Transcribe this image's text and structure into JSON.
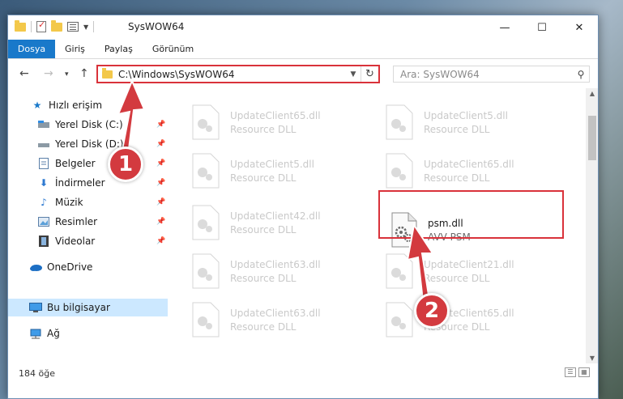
{
  "window": {
    "title": "SysWOW64",
    "controls": {
      "minimize": "—",
      "maximize": "☐",
      "close": "✕"
    }
  },
  "ribbon": {
    "tabs": [
      "Dosya",
      "Giriş",
      "Paylaş",
      "Görünüm"
    ]
  },
  "address": {
    "path": "C:\\Windows\\SysWOW64",
    "search_placeholder": "Ara: SysWOW64"
  },
  "sidebar": {
    "items": [
      {
        "label": "Hızlı erişim",
        "icon": "star-icon",
        "pinned": false
      },
      {
        "label": "Yerel Disk (C:)",
        "icon": "drive-icon",
        "pinned": true
      },
      {
        "label": "Yerel Disk (D:)",
        "icon": "drive-icon",
        "pinned": true
      },
      {
        "label": "Belgeler",
        "icon": "documents-icon",
        "pinned": true
      },
      {
        "label": "İndirmeler",
        "icon": "download-icon",
        "pinned": true
      },
      {
        "label": "Müzik",
        "icon": "music-icon",
        "pinned": true
      },
      {
        "label": "Resimler",
        "icon": "pictures-icon",
        "pinned": true
      },
      {
        "label": "Videolar",
        "icon": "videos-icon",
        "pinned": true
      },
      {
        "label": "OneDrive",
        "icon": "cloud-icon",
        "pinned": false
      },
      {
        "label": "Bu bilgisayar",
        "icon": "computer-icon",
        "pinned": false,
        "selected": true
      },
      {
        "label": "Ağ",
        "icon": "network-icon",
        "pinned": false
      }
    ]
  },
  "files": [
    {
      "name": "UpdateClient65.dll",
      "type": "Resource DLL",
      "highlighted": false
    },
    {
      "name": "UpdateClient5.dll",
      "type": "Resource DLL",
      "highlighted": false
    },
    {
      "name": "UpdateClient5.dll",
      "type": "Resource DLL",
      "highlighted": false
    },
    {
      "name": "UpdateClient65.dll",
      "type": "Resource DLL",
      "highlighted": false
    },
    {
      "name": "UpdateClient42.dll",
      "type": "Resource DLL",
      "highlighted": false
    },
    {
      "name": "psm.dll",
      "type": "AVV PSM",
      "highlighted": true
    },
    {
      "name": "UpdateClient63.dll",
      "type": "Resource DLL",
      "highlighted": false
    },
    {
      "name": "UpdateClient21.dll",
      "type": "Resource DLL",
      "highlighted": false
    },
    {
      "name": "UpdateClient63.dll",
      "type": "Resource DLL",
      "highlighted": false
    },
    {
      "name": "UpdateClient65.dll",
      "type": "Resource DLL",
      "highlighted": false
    }
  ],
  "status": {
    "item_count": "184 öğe"
  },
  "annotations": {
    "step1": "1",
    "step2": "2"
  },
  "colors": {
    "accent": "#1979ca",
    "annotation": "#d9323a",
    "selected": "#cce8ff"
  }
}
